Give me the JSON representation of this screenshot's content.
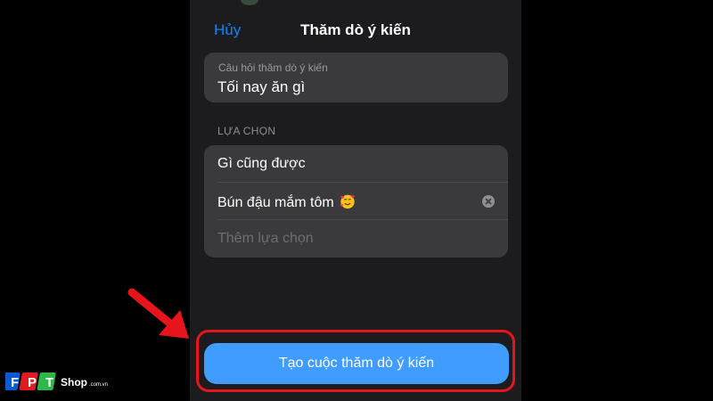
{
  "header": {
    "cancel_label": "Hủy",
    "title": "Thăm dò ý kiến"
  },
  "question": {
    "placeholder": "Câu hỏi thăm dò ý kiến",
    "value": "Tối nay ăn gì"
  },
  "options_section": {
    "label": "LỰA CHỌN",
    "options": [
      {
        "text": "Gì cũng được"
      },
      {
        "text": "Bún đậu mắm tôm",
        "emoji": "smiling-face-with-hearts",
        "has_clear": true
      }
    ],
    "add_placeholder": "Thêm lựa chọn"
  },
  "create_button_label": "Tạo cuộc thăm dò ý kiến",
  "icons": {
    "clear": "x-circle-icon",
    "annotation_arrow": "red-arrow-icon"
  },
  "watermark": {
    "brand": "FPT Shop",
    "domain": "com.vn"
  },
  "colors": {
    "accent": "#0a84ff",
    "button": "#409cff",
    "highlight": "#e8141b",
    "background": "#000000",
    "sheet": "#1c1c1e",
    "card": "#3a3a3c"
  }
}
